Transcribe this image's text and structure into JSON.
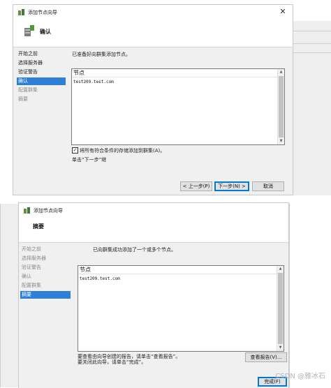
{
  "wizard1": {
    "window_title": "添加节点向导",
    "page_title": "确认",
    "nav": [
      {
        "label": "开始之前",
        "state": "normal"
      },
      {
        "label": "选择服务器",
        "state": "normal"
      },
      {
        "label": "验证警告",
        "state": "normal"
      },
      {
        "label": "确认",
        "state": "active"
      },
      {
        "label": "配置群集",
        "state": "dim"
      },
      {
        "label": "摘要",
        "state": "dim"
      }
    ],
    "intro_text": "已准备好向群集添加节点。",
    "list_header": "节点",
    "list_items": [
      "test209.test.com"
    ],
    "checkbox_checked": true,
    "checkbox_label": "将所有符合条件的存储添加到群集(A)。",
    "hint_text": "单击“下一步”继",
    "buttons": {
      "prev": "< 上一步(P)",
      "next": "下一步(N) >",
      "cancel": "取消"
    }
  },
  "wizard2": {
    "window_title": "添加节点向导",
    "page_title": "摘要",
    "nav": [
      {
        "label": "开始之前",
        "state": "dim"
      },
      {
        "label": "选择服务器",
        "state": "dim"
      },
      {
        "label": "验证警告",
        "state": "dim"
      },
      {
        "label": "确认",
        "state": "dim"
      },
      {
        "label": "配置群集",
        "state": "dim"
      },
      {
        "label": "摘要",
        "state": "active"
      }
    ],
    "intro_text": "已向群集成功添加了一个或多个节点。",
    "list_header": "节点",
    "list_items": [
      "test209.test.com"
    ],
    "report_text_1": "要查看由向导创建的报告，请单击“查看报告”。",
    "report_text_2": "要关闭此向导，请单击“完成”。",
    "buttons": {
      "view_report": "查看报告(V)...",
      "finish": "完成(F)"
    }
  },
  "watermark": "CSDN @雅冰石",
  "colors": {
    "accent": "#2e7fd6",
    "panel": "#f0f0f0"
  }
}
